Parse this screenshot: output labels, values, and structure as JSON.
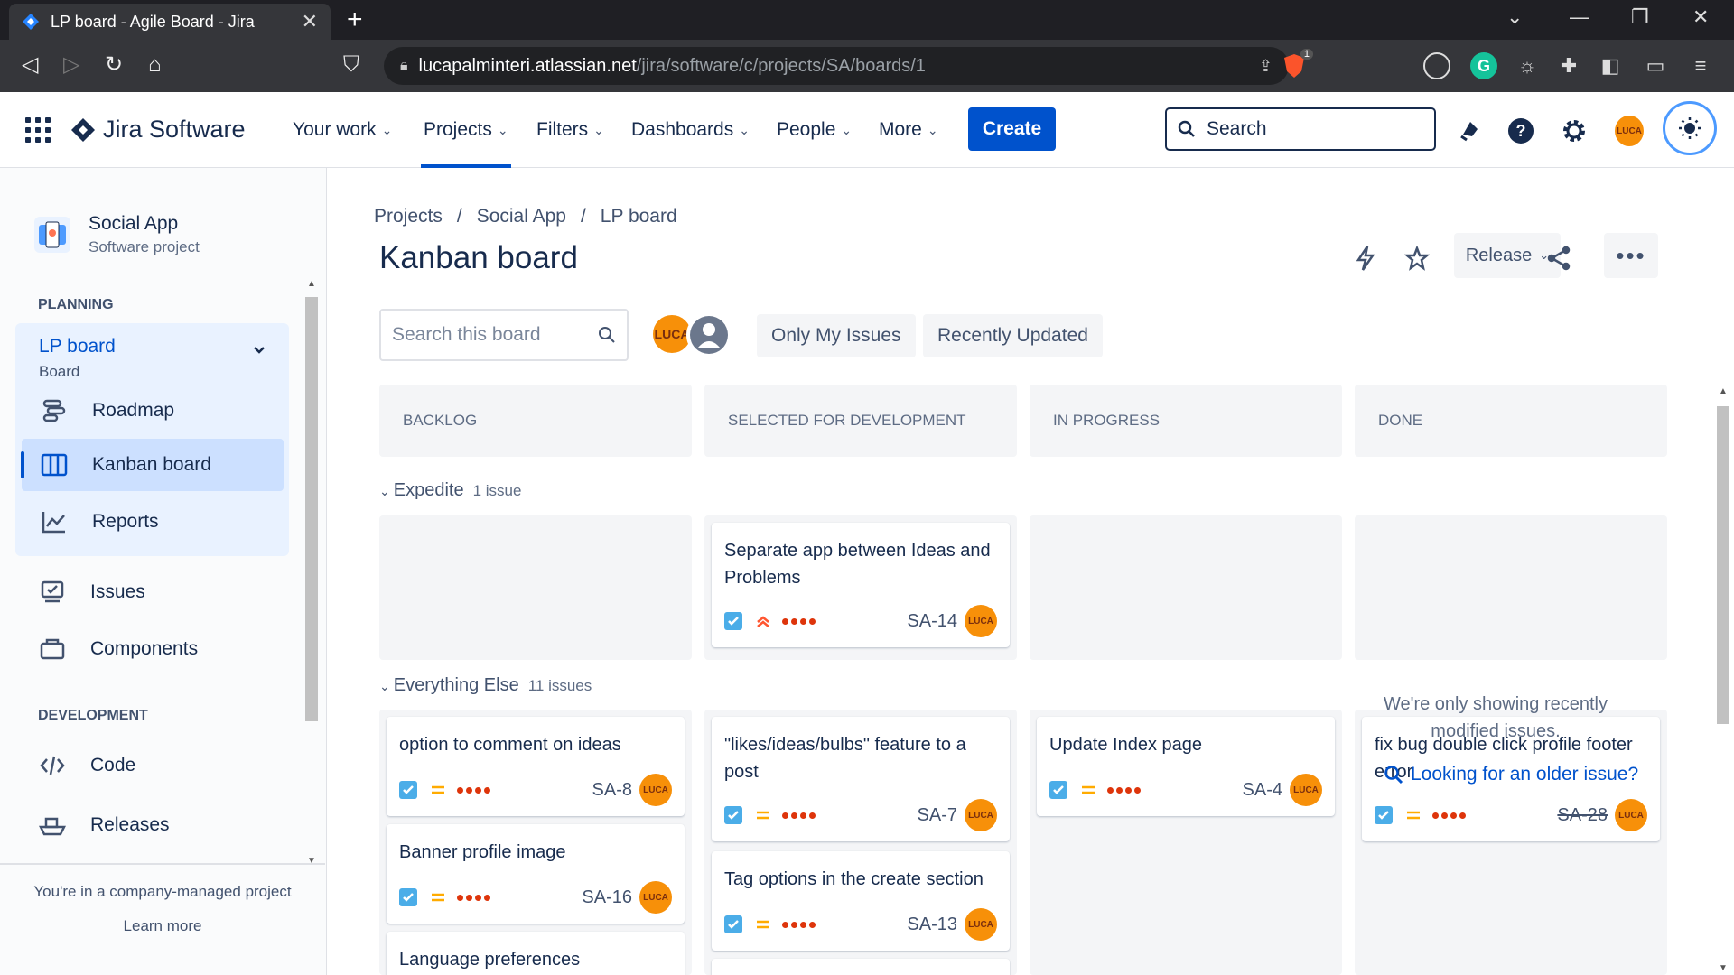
{
  "browser": {
    "tab_title": "LP board - Agile Board - Jira",
    "url_host": "lucapalminteri.atlassian.net",
    "url_path": "/jira/software/c/projects/SA/boards/1",
    "brave_badge": "1"
  },
  "topnav": {
    "product": "Jira Software",
    "items": [
      "Your work",
      "Projects",
      "Filters",
      "Dashboards",
      "People",
      "More"
    ],
    "active": "Projects",
    "create_label": "Create",
    "search_placeholder": "Search",
    "avatar_label": "LUCA"
  },
  "sidebar": {
    "project_name": "Social App",
    "project_type": "Software project",
    "planning_heading": "PLANNING",
    "board_group": {
      "title": "LP board",
      "subtitle": "Board"
    },
    "board_items": [
      "Roadmap",
      "Kanban board",
      "Reports"
    ],
    "other_items": [
      "Issues",
      "Components"
    ],
    "development_heading": "DEVELOPMENT",
    "dev_items": [
      "Code",
      "Releases"
    ],
    "footer_text": "You're in a company-managed project",
    "learn_more": "Learn more"
  },
  "main": {
    "breadcrumbs": [
      "Projects",
      "Social App",
      "LP board"
    ],
    "title": "Kanban board",
    "release_label": "Release",
    "board_search_placeholder": "Search this board",
    "avatar_label": "LUCA",
    "quick_filters": [
      "Only My Issues",
      "Recently Updated"
    ],
    "columns": [
      "BACKLOG",
      "SELECTED FOR DEVELOPMENT",
      "IN PROGRESS",
      "DONE"
    ],
    "swimlanes": [
      {
        "name": "Expedite",
        "count": "1 issue"
      },
      {
        "name": "Everything Else",
        "count": "11 issues"
      }
    ],
    "cards": {
      "sa14": {
        "title": "Separate app between Ideas and Problems",
        "key": "SA-14",
        "priority": "highest"
      },
      "sa8": {
        "title": "option to comment on ideas",
        "key": "SA-8",
        "priority": "medium"
      },
      "sa16": {
        "title": "Banner profile image",
        "key": "SA-16",
        "priority": "medium"
      },
      "lang": {
        "title": "Language preferences"
      },
      "sa7": {
        "title": "\"likes/ideas/bulbs\" feature to a post",
        "key": "SA-7",
        "priority": "medium"
      },
      "sa13": {
        "title": "Tag options in the create section",
        "key": "SA-13",
        "priority": "medium"
      },
      "sa4": {
        "title": "Update Index page",
        "key": "SA-4",
        "priority": "medium"
      },
      "sa28": {
        "title": "fix bug double click profile footer error",
        "key": "SA-28",
        "priority": "medium"
      }
    },
    "done_note": "We're only showing recently modified issues.",
    "older_link": "Looking for an older issue?"
  },
  "colors": {
    "brand_blue": "#0052cc",
    "avatar_orange": "#f79009",
    "priority_highest": "#ff5630",
    "priority_medium": "#ffab00",
    "story_points_red": "#de350b"
  }
}
